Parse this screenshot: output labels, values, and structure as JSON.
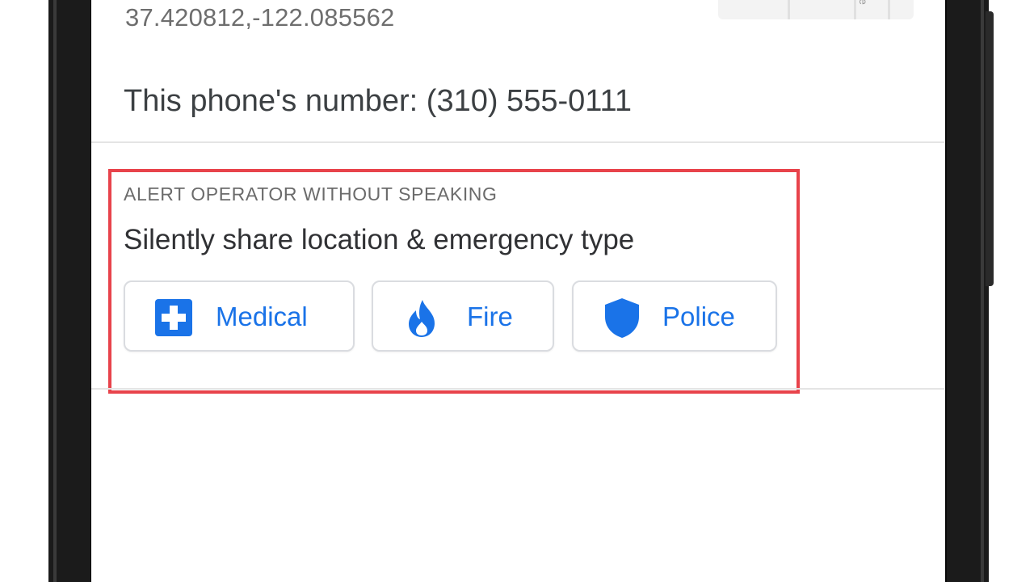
{
  "location": {
    "coordinates": "37.420812,-122.085562",
    "map_label": "e"
  },
  "phone": {
    "number_text": "This phone's number: (310) 555-0111"
  },
  "silent_alert": {
    "caption": "ALERT OPERATOR WITHOUT SPEAKING",
    "title": "Silently share location & emergency type",
    "options": [
      {
        "label": "Medical",
        "icon": "medical-cross-icon"
      },
      {
        "label": "Fire",
        "icon": "flame-icon"
      },
      {
        "label": "Police",
        "icon": "shield-icon"
      }
    ]
  },
  "colors": {
    "accent_blue": "#1a73e8",
    "highlight_red": "#e8434b",
    "caption_gray": "#6b6b6b",
    "text_dark": "#303134"
  }
}
